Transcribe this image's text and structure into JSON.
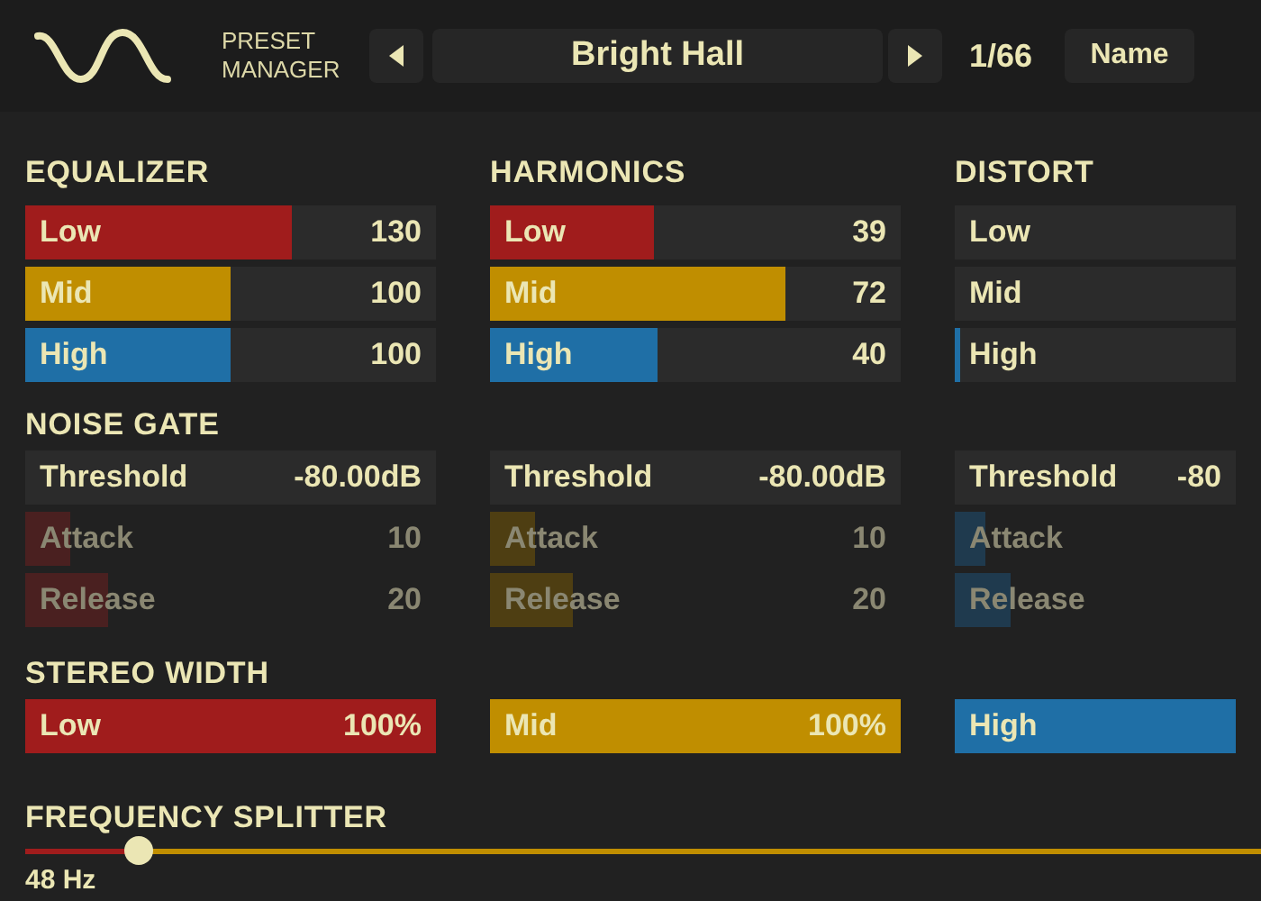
{
  "header": {
    "preset_label": "PRESET MANAGER",
    "preset_name": "Bright Hall",
    "counter": "1/66",
    "sort_button": "Name"
  },
  "band_groups": [
    {
      "title": "EQUALIZER",
      "params": [
        {
          "label": "Low",
          "value": "130",
          "level": 0.65,
          "color": "#a01c1c"
        },
        {
          "label": "Mid",
          "value": "100",
          "level": 0.5,
          "color": "#c08e00"
        },
        {
          "label": "High",
          "value": "100",
          "level": 0.5,
          "color": "#1f6fa6"
        }
      ]
    },
    {
      "title": "HARMONICS",
      "params": [
        {
          "label": "Low",
          "value": "39",
          "level": 0.4,
          "color": "#a01c1c"
        },
        {
          "label": "Mid",
          "value": "72",
          "level": 0.72,
          "color": "#c08e00"
        },
        {
          "label": "High",
          "value": "40",
          "level": 0.41,
          "color": "#1f6fa6"
        }
      ]
    },
    {
      "title": "DISTORT",
      "params": [
        {
          "label": "Low"
        },
        {
          "label": "Mid"
        },
        {
          "label": "High",
          "level": 0.02,
          "color": "#1f6fa6"
        }
      ]
    }
  ],
  "noise_gate": {
    "title": "NOISE GATE",
    "columns": [
      {
        "params": [
          {
            "kind": "readout",
            "label": "Threshold",
            "value": "-80.00dB",
            "disabled": false
          },
          {
            "kind": "bar",
            "label": "Attack",
            "value": "10",
            "level": 0.11,
            "color": "#4a2020",
            "disabled": true
          },
          {
            "kind": "bar",
            "label": "Release",
            "value": "20",
            "level": 0.2,
            "color": "#4a2020",
            "disabled": true
          }
        ]
      },
      {
        "params": [
          {
            "kind": "readout",
            "label": "Threshold",
            "value": "-80.00dB",
            "disabled": false
          },
          {
            "kind": "bar",
            "label": "Attack",
            "value": "10",
            "level": 0.11,
            "color": "#4e3e12",
            "disabled": true
          },
          {
            "kind": "bar",
            "label": "Release",
            "value": "20",
            "level": 0.2,
            "color": "#4e3e12",
            "disabled": true
          }
        ]
      },
      {
        "params": [
          {
            "kind": "readout",
            "label": "Threshold",
            "value": "-80",
            "disabled": false
          },
          {
            "kind": "bar",
            "label": "Attack",
            "level": 0.11,
            "color": "#1f3a4e",
            "disabled": true
          },
          {
            "kind": "bar",
            "label": "Release",
            "level": 0.2,
            "color": "#1f3a4e",
            "disabled": true
          }
        ]
      }
    ]
  },
  "stereo_width": {
    "title": "STEREO WIDTH",
    "params": [
      {
        "label": "Low",
        "value": "100%",
        "level": 1,
        "color": "#a01c1c"
      },
      {
        "label": "Mid",
        "value": "100%",
        "level": 1,
        "color": "#c08e00"
      },
      {
        "label": "High",
        "level": 1,
        "color": "#1f6fa6"
      }
    ]
  },
  "frequency_splitter": {
    "title": "FREQUENCY SPLITTER",
    "level": 0.09,
    "value": "48 Hz"
  }
}
